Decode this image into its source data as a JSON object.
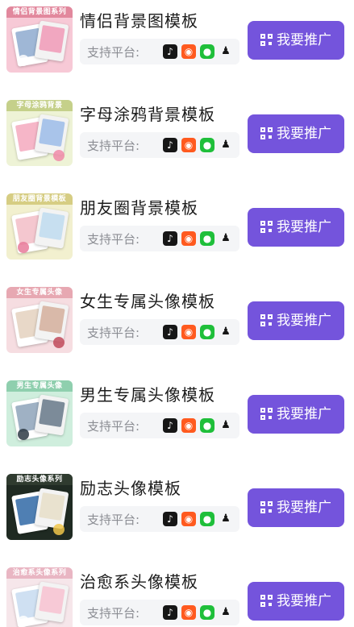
{
  "items": [
    {
      "title": "情侣背景图模板",
      "thumb_caption": "情侣背景图系列",
      "platform_label": "支持平台:",
      "button_label": "我要推广",
      "thumb_colors": {
        "bg": "#f7c9d6",
        "caption_bg": "#e2889d",
        "card1": "#9fb7d6",
        "card2": "#f1a7c0",
        "blob": "#ffffff"
      }
    },
    {
      "title": "字母涂鸦背景模板",
      "thumb_caption": "字母涂鸦背景",
      "platform_label": "支持平台:",
      "button_label": "我要推广",
      "thumb_colors": {
        "bg": "#eef3d6",
        "caption_bg": "#c5d08a",
        "card1": "#f6b6c8",
        "card2": "#a9c4ea",
        "blob": "#f08aa8"
      }
    },
    {
      "title": "朋友圈背景模板",
      "thumb_caption": "朋友圈背景模板",
      "platform_label": "支持平台:",
      "button_label": "我要推广",
      "thumb_colors": {
        "bg": "#f2f0cf",
        "caption_bg": "#d6cd83",
        "card1": "#f4c7cf",
        "card2": "#c7dff0",
        "blob": "#e87a9a"
      }
    },
    {
      "title": "女生专属头像模板",
      "thumb_caption": "女生专属头像",
      "platform_label": "支持平台:",
      "button_label": "我要推广",
      "thumb_colors": {
        "bg": "#f6dde1",
        "caption_bg": "#e7a8b2",
        "card1": "#e8d8c8",
        "card2": "#d9b9a9",
        "blob": "#c14a5a"
      }
    },
    {
      "title": "男生专属头像模板",
      "thumb_caption": "男生专属头像",
      "platform_label": "支持平台:",
      "button_label": "我要推广",
      "thumb_colors": {
        "bg": "#cfeedd",
        "caption_bg": "#8fcfae",
        "card1": "#9fb1c4",
        "card2": "#7c8b99",
        "blob": "#2d3a44"
      }
    },
    {
      "title": "励志头像模板",
      "thumb_caption": "励志头像系列",
      "platform_label": "支持平台:",
      "button_label": "我要推广",
      "thumb_colors": {
        "bg": "#1f2a22",
        "caption_bg": "#2f3b2f",
        "card1": "#4f7fb3",
        "card2": "#e9e2cf",
        "blob": "#f0c64a"
      }
    },
    {
      "title": "治愈系头像模板",
      "thumb_caption": "治愈系头像系列",
      "platform_label": "支持平台:",
      "button_label": "我要推广",
      "thumb_colors": {
        "bg": "#f6e6ea",
        "caption_bg": "#e9b6c3",
        "card1": "#cfe0f2",
        "card2": "#f7c9d6",
        "blob": "#ffffff"
      }
    }
  ],
  "platform_icons": [
    {
      "name": "douyin-icon",
      "glyph": "♪"
    },
    {
      "name": "kuaishou-icon",
      "glyph": "◉"
    },
    {
      "name": "wechat-icon",
      "glyph": "●"
    },
    {
      "name": "qq-icon",
      "glyph": "♟"
    }
  ],
  "accent_color": "#7454dc"
}
